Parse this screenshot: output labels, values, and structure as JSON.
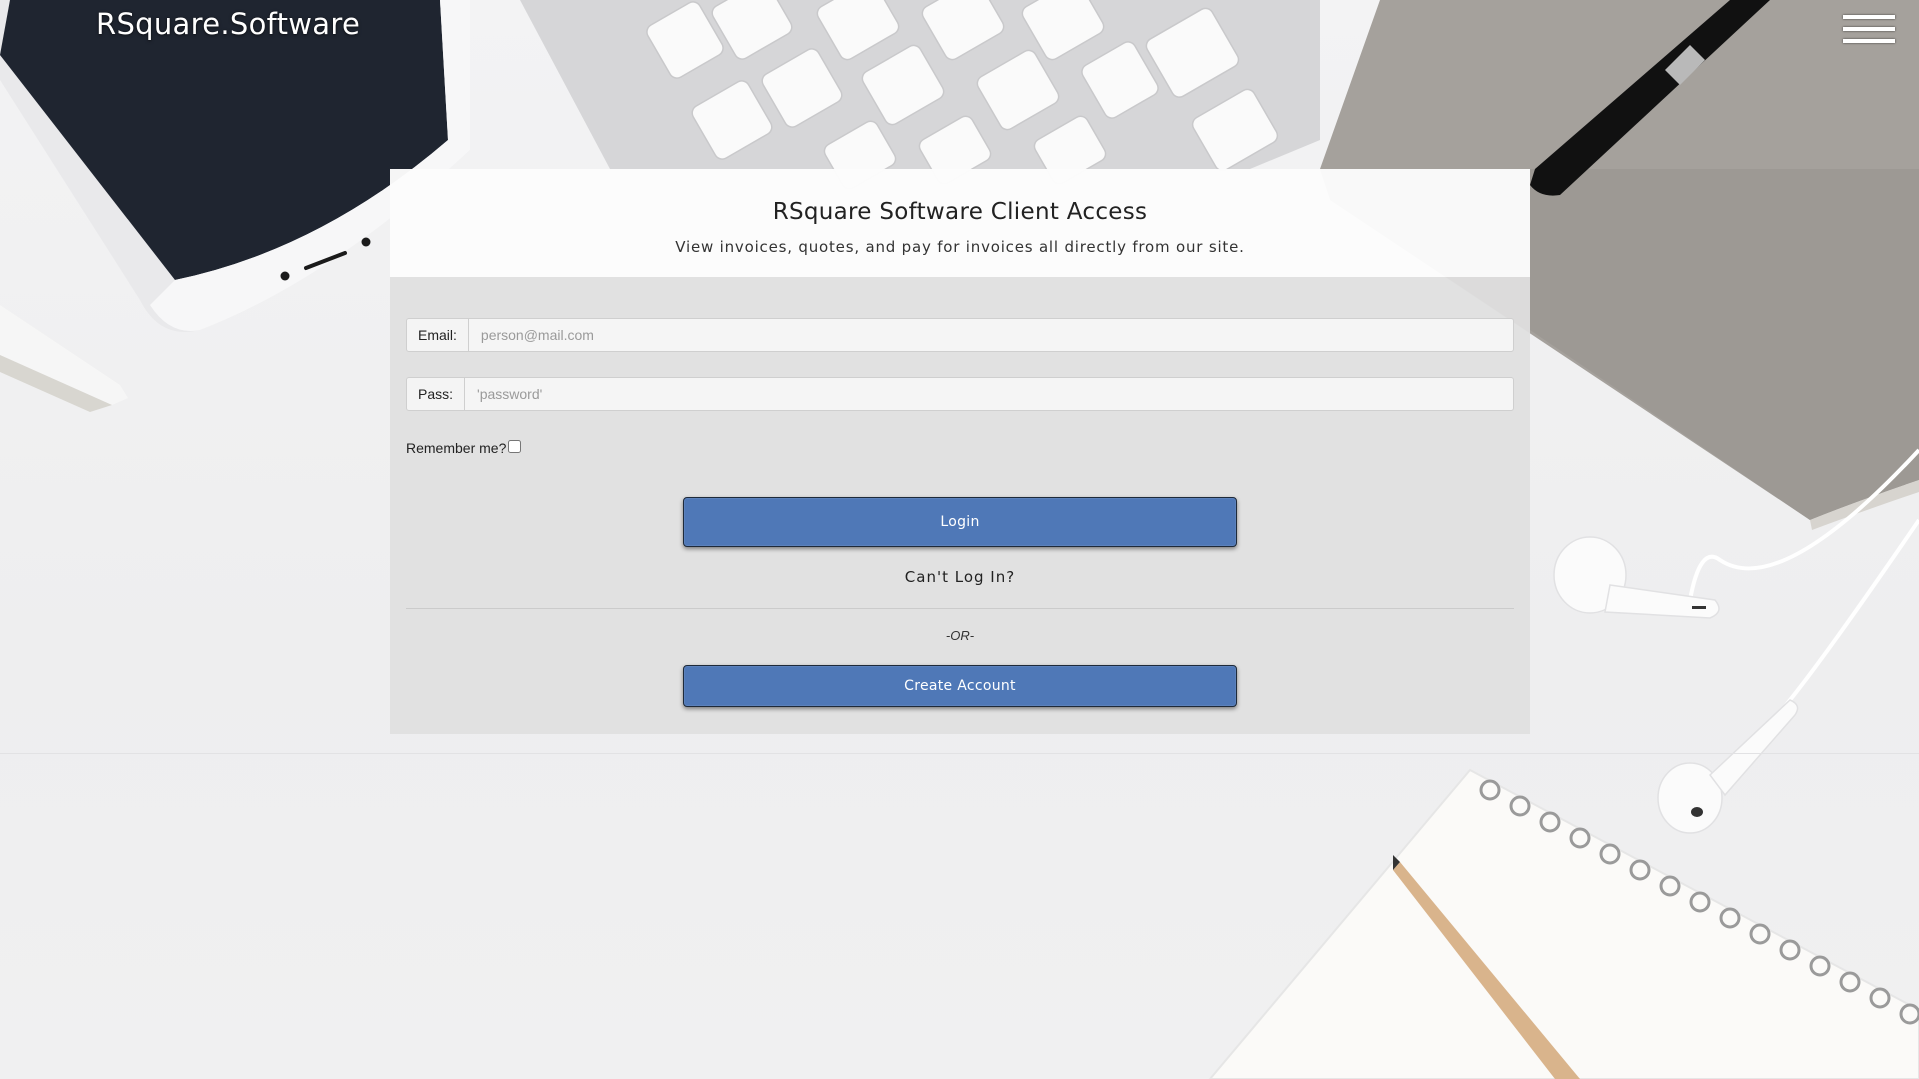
{
  "header": {
    "brand": "RSquare.Software",
    "menu_icon": "hamburger-menu-icon"
  },
  "card": {
    "title": "RSquare Software Client Access",
    "subtitle": "View invoices, quotes, and pay for invoices all directly from our site."
  },
  "form": {
    "email_label": "Email:",
    "email_placeholder": "person@mail.com",
    "email_value": "",
    "pass_label": "Pass:",
    "pass_placeholder": "'password'",
    "pass_value": "",
    "remember_label": "Remember me?",
    "remember_checked": false,
    "login_label": "Login",
    "cant_login_label": "Can't Log In?",
    "or_label": "-OR-",
    "create_account_label": "Create Account"
  },
  "colors": {
    "primary_button": "#4f78b7",
    "card_header": "#fcfcfc",
    "card_body": "#e0e0e0"
  }
}
